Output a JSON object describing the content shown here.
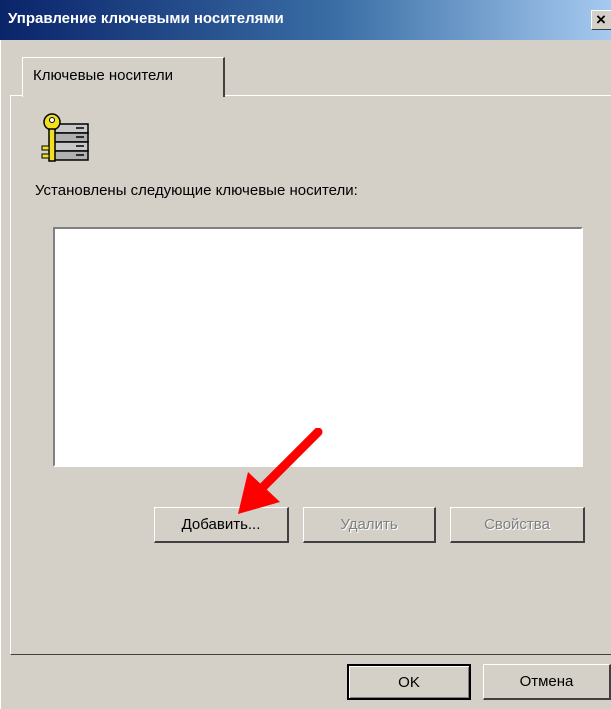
{
  "window": {
    "title": "Управление ключевыми носителями",
    "close_symbol": "✕"
  },
  "tabs": [
    {
      "label": "Ключевые носители",
      "active": true
    }
  ],
  "panel": {
    "icon": "key-storage-icon",
    "list_label": "Установлены следующие ключевые носители:",
    "items": []
  },
  "buttons": {
    "add": {
      "label": "Добавить...",
      "enabled": true
    },
    "remove": {
      "label": "Удалить",
      "enabled": false
    },
    "properties": {
      "label": "Свойства",
      "enabled": false
    },
    "ok": {
      "label": "OK",
      "enabled": true
    },
    "cancel": {
      "label": "Отмена",
      "enabled": true
    }
  },
  "annotation": {
    "icon": "red-arrow-icon",
    "color": "#ff0000"
  }
}
